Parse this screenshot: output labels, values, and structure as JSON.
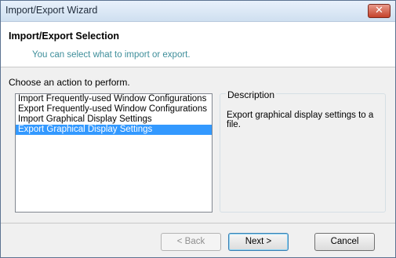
{
  "window": {
    "title": "Import/Export Wizard"
  },
  "header": {
    "title": "Import/Export Selection",
    "subtitle": "You can select what to import or export."
  },
  "main": {
    "prompt": "Choose an action to perform.",
    "actions": [
      "Import Frequently-used Window Configurations",
      "Export Frequently-used Window Configurations",
      "Import Graphical Display Settings",
      "Export Graphical Display Settings"
    ],
    "selected_index": 3
  },
  "description": {
    "label": "Description",
    "text": "Export graphical display settings to a file."
  },
  "buttons": {
    "back": {
      "label": "< Back",
      "disabled": true
    },
    "next": {
      "label": "Next >"
    },
    "cancel": {
      "label": "Cancel"
    }
  },
  "icons": {
    "close": "close-icon"
  }
}
